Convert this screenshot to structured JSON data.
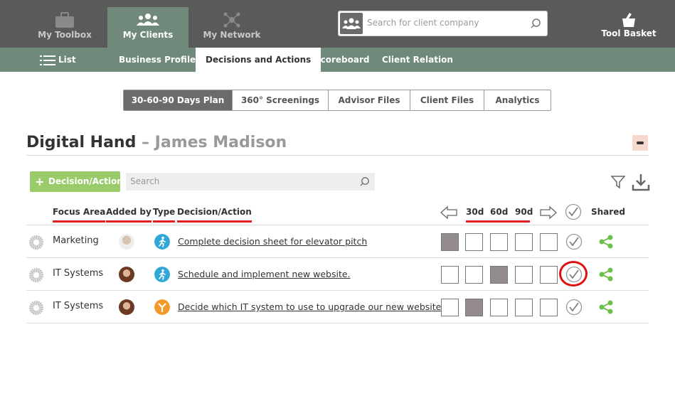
{
  "topnav": {
    "items": [
      {
        "label": "My Toolbox"
      },
      {
        "label": "My Clients"
      },
      {
        "label": "My Network"
      }
    ],
    "search_placeholder": "Search for client company",
    "tool_basket": "Tool Basket"
  },
  "subnav": {
    "list": "List",
    "items": [
      "Business Profile",
      "Decisions and Actions",
      "Scoreboard",
      "Client Relation"
    ]
  },
  "pills": [
    "30-60-90 Days Plan",
    "360° Screenings",
    "Advisor Files",
    "Client Files",
    "Analytics"
  ],
  "page": {
    "company": "Digital Hand",
    "person": "– James Madison"
  },
  "toolbar": {
    "add_label": "Decision/Action",
    "search_placeholder": "Search"
  },
  "table": {
    "headers": {
      "focus_area": "Focus Area",
      "added_by": "Added by",
      "type": "Type",
      "decision": "Decision/Action",
      "d30": "30d",
      "d60": "60d",
      "d90": "90d",
      "shared": "Shared"
    },
    "rows": [
      {
        "focus": "Marketing",
        "decision": "Complete decision sheet for elevator pitch",
        "type": "person",
        "filled_box": 0
      },
      {
        "focus": "IT Systems",
        "decision": "Schedule and implement new website.",
        "type": "person",
        "filled_box": 2
      },
      {
        "focus": "IT Systems",
        "decision": "Decide which IT system to use to upgrade our new website.",
        "type": "split",
        "filled_box": 1
      }
    ]
  },
  "colors": {
    "topbar": "#5a5a5a",
    "active_nav": "#71897a",
    "subnav": "#6f8a7b",
    "green_button": "#9acb6b",
    "highlight_red": "#e02020",
    "type_person": "#2fa8d8",
    "type_split": "#f39a2b",
    "share_green": "#6cc04a"
  }
}
